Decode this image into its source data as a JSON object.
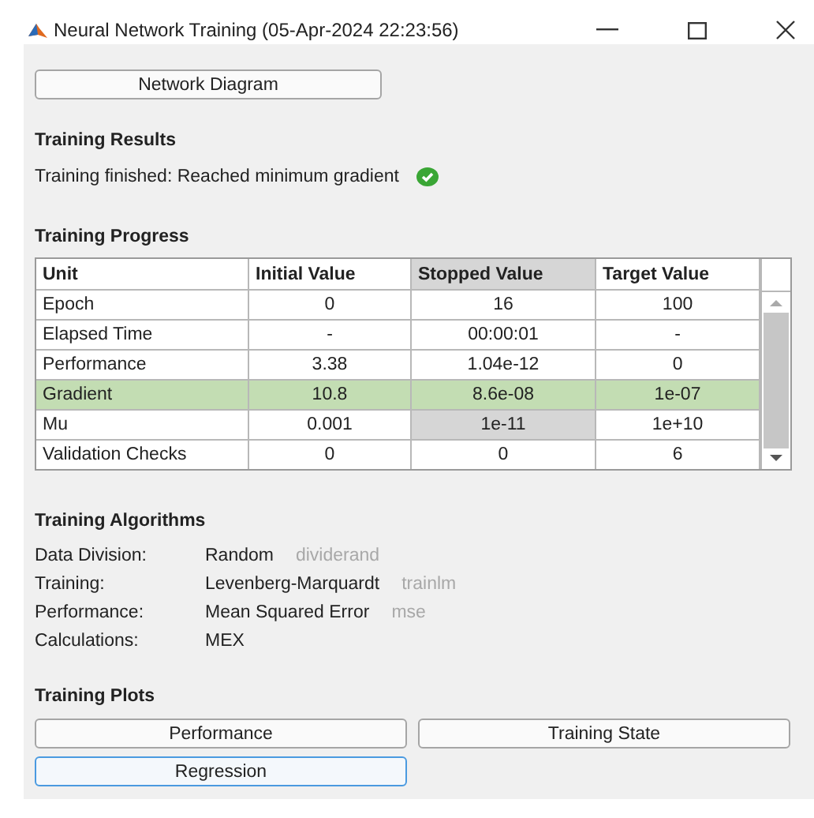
{
  "window": {
    "title": "Neural Network Training (05-Apr-2024 22:23:56)"
  },
  "network_button": {
    "label": "Network Diagram",
    "focused": false
  },
  "results": {
    "heading": "Training Results",
    "status": "Training finished: Reached minimum gradient",
    "success": true
  },
  "progress": {
    "heading": "Training Progress",
    "columns": [
      {
        "label": "Unit",
        "selected": false
      },
      {
        "label": "Initial Value",
        "selected": false
      },
      {
        "label": "Stopped Value",
        "selected": true
      },
      {
        "label": "Target Value",
        "selected": false
      }
    ],
    "rows": [
      {
        "unit": "Epoch",
        "initial": "0",
        "stopped": "16",
        "target": "100",
        "met": false,
        "stopped_selected": false
      },
      {
        "unit": "Elapsed Time",
        "initial": "-",
        "stopped": "00:00:01",
        "target": "-",
        "met": false,
        "stopped_selected": false
      },
      {
        "unit": "Performance",
        "initial": "3.38",
        "stopped": "1.04e-12",
        "target": "0",
        "met": false,
        "stopped_selected": false
      },
      {
        "unit": "Gradient",
        "initial": "10.8",
        "stopped": "8.6e-08",
        "target": "1e-07",
        "met": true,
        "stopped_selected": false
      },
      {
        "unit": "Mu",
        "initial": "0.001",
        "stopped": "1e-11",
        "target": "1e+10",
        "met": false,
        "stopped_selected": true
      },
      {
        "unit": "Validation Checks",
        "initial": "0",
        "stopped": "0",
        "target": "6",
        "met": false,
        "stopped_selected": false
      }
    ]
  },
  "algorithms": {
    "heading": "Training Algorithms",
    "items": [
      {
        "label": "Data Division:",
        "value": "Random",
        "function": "dividerand"
      },
      {
        "label": "Training:",
        "value": "Levenberg-Marquardt",
        "function": "trainlm"
      },
      {
        "label": "Performance:",
        "value": "Mean Squared Error",
        "function": "mse"
      },
      {
        "label": "Calculations:",
        "value": "MEX"
      }
    ]
  },
  "plots": {
    "heading": "Training Plots",
    "buttons": [
      {
        "label": "Performance",
        "focused": false
      },
      {
        "label": "Training State",
        "focused": false
      },
      {
        "label": "Regression",
        "focused": true
      }
    ]
  }
}
